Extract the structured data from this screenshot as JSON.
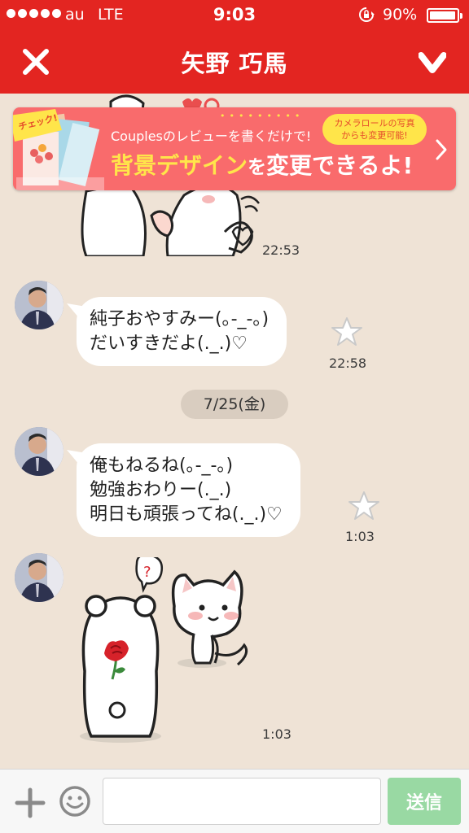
{
  "status_bar": {
    "carrier": "au",
    "network": "LTE",
    "time": "9:03",
    "battery": "90%",
    "battery_level": 0.9
  },
  "header": {
    "title": "矢野 巧馬"
  },
  "banner": {
    "tag": "チェック!",
    "line1": "Couplesのレビューを書くだけで!",
    "line2_highlight": "背景デザイン",
    "line2_particle": "を",
    "line2_rest": "変更できるよ!",
    "bubble_line1": "カメラロールの写真",
    "bubble_line2": "からも変更可能!"
  },
  "messages": [
    {
      "type": "sticker",
      "time": "22:53"
    },
    {
      "type": "text",
      "lines": [
        "純子おやすみー(｡-_-｡)",
        "だいすきだよ(._.)♡"
      ],
      "time": "22:58"
    },
    {
      "type": "date",
      "label": "7/25(金)"
    },
    {
      "type": "text",
      "lines": [
        "俺もねるね(｡-_-｡)",
        "勉強おわりー(._.)",
        "明日も頑張ってね(._.)♡"
      ],
      "time": "1:03"
    },
    {
      "type": "sticker",
      "time": "1:03"
    }
  ],
  "input": {
    "placeholder": "",
    "send_label": "送信"
  },
  "colors": {
    "brand_red": "#e32521",
    "background": "#efe3d6",
    "send_green": "#99d9a3",
    "banner_pink": "#f96b6c",
    "banner_yellow": "#ffe54a"
  },
  "icons": [
    "close-icon",
    "chevron-down-icon",
    "star-icon",
    "plus-icon",
    "smiley-icon",
    "chevron-right-icon",
    "rotation-lock-icon"
  ]
}
